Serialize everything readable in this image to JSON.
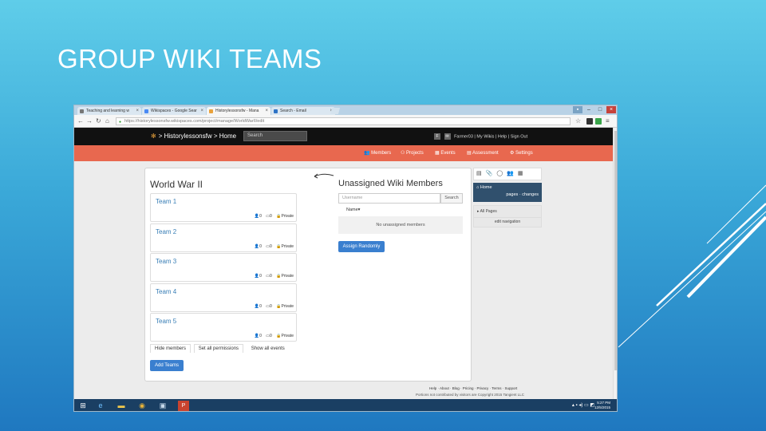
{
  "slide": {
    "title": "GROUP WIKI TEAMS"
  },
  "browser": {
    "tabs": [
      {
        "label": "Teaching and learning w"
      },
      {
        "label": "Wikispaces - Google Sear"
      },
      {
        "label": "Historylessonsfw - Mana"
      },
      {
        "label": "Search - Email"
      }
    ],
    "url": "https://historylessonsfw.wikispaces.com/project/manage/WorldWarII/edit"
  },
  "site": {
    "brand": "> Historylessonsfw > Home",
    "search_placeholder": "Search",
    "user": "Farmer03",
    "user_links": [
      "My Wikis",
      "Help",
      "Sign Out"
    ],
    "nav": [
      "Members",
      "Projects",
      "Events",
      "Assessment",
      "Settings"
    ]
  },
  "project": {
    "title": "World War II",
    "teams": [
      {
        "name": "Team 1",
        "members": "0",
        "pages": "0",
        "visibility": "Private"
      },
      {
        "name": "Team 2",
        "members": "0",
        "pages": "0",
        "visibility": "Private"
      },
      {
        "name": "Team 3",
        "members": "0",
        "pages": "0",
        "visibility": "Private"
      },
      {
        "name": "Team 4",
        "members": "0",
        "pages": "0",
        "visibility": "Private"
      },
      {
        "name": "Team 5",
        "members": "0",
        "pages": "0",
        "visibility": "Private"
      }
    ],
    "tabs": [
      "Hide members",
      "Set all permissions",
      "Show all events"
    ],
    "add_teams": "Add Teams"
  },
  "unassigned": {
    "title": "Unassigned Wiki Members",
    "username_placeholder": "Username",
    "search": "Search",
    "name_col": "Name▾",
    "empty": "No unassigned members",
    "assign": "Assign Randomly"
  },
  "sidebar": {
    "home": "Home",
    "pages": "pages",
    "changes": "changes",
    "all_pages": "▸ All Pages",
    "edit": "edit navigation"
  },
  "footer": {
    "links": "Help · About · Blog · Pricing · Privacy · Terms · Support",
    "copyright": "Portions not contributed by visitors are Copyright 2015 Tangient LLC"
  },
  "taskbar": {
    "time": "5:27 PM",
    "date": "12/5/2015"
  }
}
